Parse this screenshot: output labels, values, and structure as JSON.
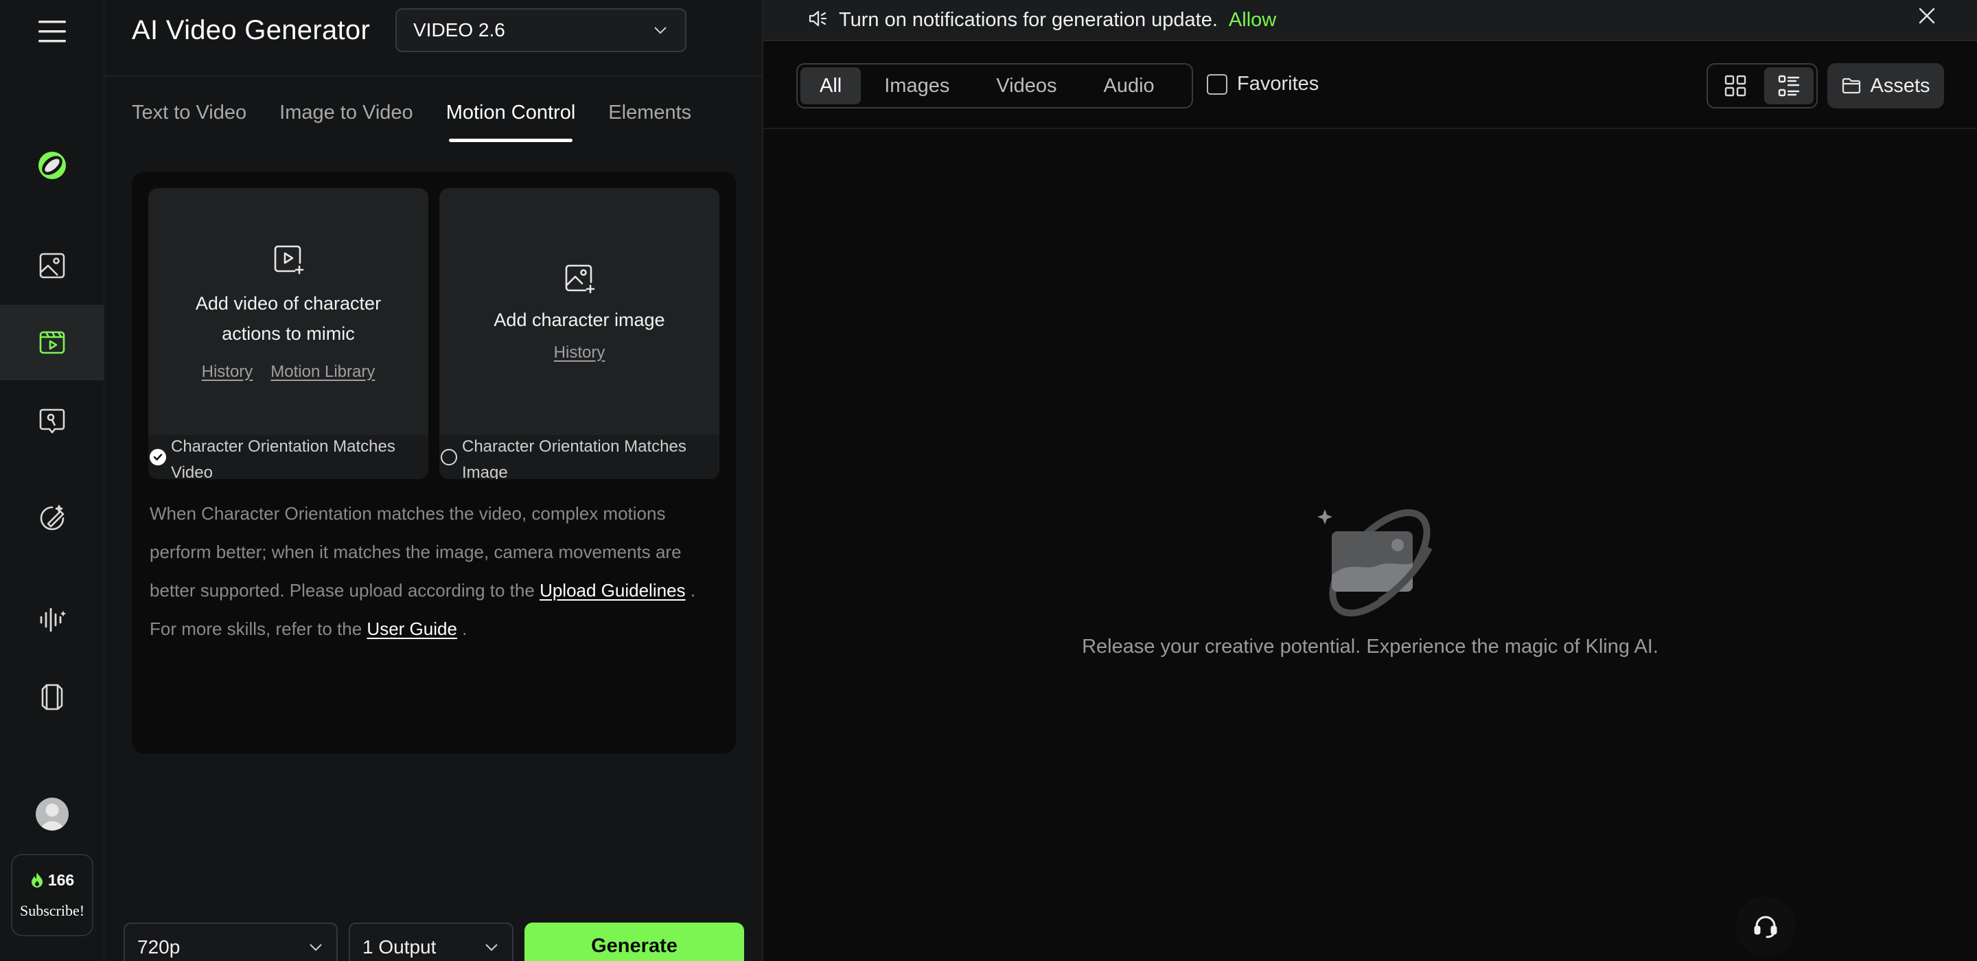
{
  "app": {
    "title": "AI Video Generator",
    "model": "VIDEO 2.6"
  },
  "tabs": [
    {
      "label": "Text to Video"
    },
    {
      "label": "Image to Video"
    },
    {
      "label": "Motion Control"
    },
    {
      "label": "Elements"
    }
  ],
  "active_tab": "Motion Control",
  "upload": {
    "video_card": {
      "title": "Add video of character actions to mimic",
      "history": "History",
      "library": "Motion Library",
      "orientation": "Character Orientation Matches Video",
      "selected": true
    },
    "image_card": {
      "title": "Add character image",
      "history": "History",
      "orientation": "Character Orientation Matches Image",
      "selected": false
    }
  },
  "help": {
    "part1": "When Character Orientation matches the video, complex motions perform better; when it matches the image, camera movements are better supported. Please upload according to the ",
    "link1": "Upload Guidelines",
    "part2": " . For more skills, refer to the ",
    "link2": "User Guide",
    "part3": " ."
  },
  "controls": {
    "resolution": "720p",
    "outputs": "1 Output",
    "generate": "Generate"
  },
  "sidebar": {
    "credits": "166",
    "subscribe": "Subscribe!"
  },
  "notification": {
    "text": "Turn on notifications for generation update.",
    "allow": "Allow"
  },
  "filters": [
    {
      "label": "All"
    },
    {
      "label": "Images"
    },
    {
      "label": "Videos"
    },
    {
      "label": "Audio"
    }
  ],
  "favorites_label": "Favorites",
  "assets_label": "Assets",
  "empty_message": "Release your creative potential. Experience the magic of Kling AI.",
  "colors": {
    "accent": "#7cf552",
    "bg": "#0b0b0b",
    "panel": "#141516",
    "card": "#1f2123"
  }
}
